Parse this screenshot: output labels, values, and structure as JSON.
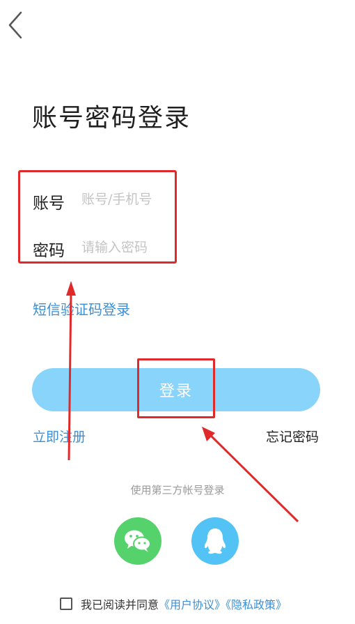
{
  "page": {
    "title": "账号密码登录"
  },
  "form": {
    "account_label": "账号",
    "account_placeholder": "账号/手机号",
    "password_label": "密码",
    "password_placeholder": "请输入密码"
  },
  "links": {
    "sms_login": "短信验证码登录",
    "register": "立即注册",
    "forgot_password": "忘记密码"
  },
  "login_button": {
    "label": "登录"
  },
  "third_party": {
    "label": "使用第三方帐号登录",
    "providers": [
      "wechat-icon",
      "qq-icon"
    ]
  },
  "agreement": {
    "prefix": "我已阅读并同意",
    "user_agreement": "《用户协议》",
    "privacy_policy": "《隐私政策》"
  },
  "colors": {
    "accent": "#3a8fd6",
    "login_button": "#89d4fb",
    "wechat": "#56d26d",
    "qq": "#53c3f5",
    "annotation": "#e02a2a"
  }
}
